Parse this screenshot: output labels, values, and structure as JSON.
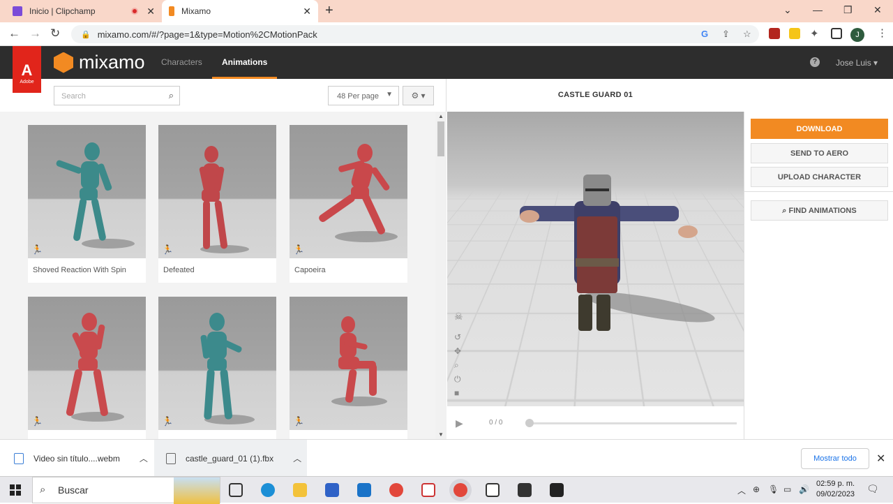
{
  "browser": {
    "tabs": [
      {
        "title": "Inicio | Clipchamp",
        "recording": true
      },
      {
        "title": "Mixamo",
        "active": true
      }
    ],
    "url": "mixamo.com/#/?page=1&type=Motion%2CMotionPack",
    "profile_initial": "J"
  },
  "app": {
    "brand": "mixamo",
    "adobe_text": "Adobe",
    "nav": [
      {
        "label": "Characters",
        "active": false
      },
      {
        "label": "Animations",
        "active": true
      }
    ],
    "help_label": "?",
    "user_name": "Jose Luis"
  },
  "toolbar": {
    "search_placeholder": "Search",
    "per_page": "48 Per page"
  },
  "animations": [
    {
      "name": "Shoved Reaction With Spin",
      "color": "#3c8a8a"
    },
    {
      "name": "Defeated",
      "color": "#c0474a"
    },
    {
      "name": "Capoeira",
      "color": "#c9484b"
    },
    {
      "name": "",
      "color": "#c94a4d"
    },
    {
      "name": "",
      "color": "#3c8a8c"
    },
    {
      "name": "",
      "color": "#c9494b"
    }
  ],
  "viewer": {
    "character_title": "CASTLE GUARD 01",
    "time": "0 / 0"
  },
  "actions": {
    "download": "DOWNLOAD",
    "send_to_aero": "SEND TO AERO",
    "upload_character": "UPLOAD CHARACTER",
    "find_animations": "FIND ANIMATIONS"
  },
  "downloads": {
    "items": [
      {
        "name": "Video sin título....webm"
      },
      {
        "name": "castle_guard_01 (1).fbx"
      }
    ],
    "show_all": "Mostrar todo"
  },
  "taskbar": {
    "search_label": "Buscar",
    "time": "02:59 p. m.",
    "date": "09/02/2023"
  },
  "colors": {
    "accent": "#f28a22",
    "header_bg": "#2d2d2d",
    "adobe_red": "#e1251b"
  }
}
